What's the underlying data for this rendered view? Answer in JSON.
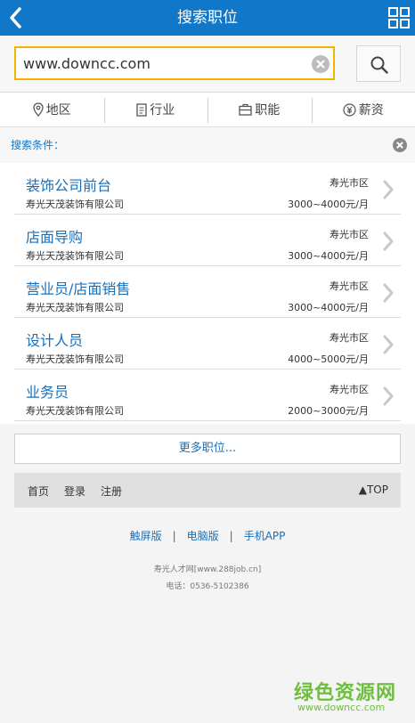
{
  "header": {
    "title": "搜索职位",
    "back_icon": "chevron-left-icon",
    "menu_icon": "grid-icon"
  },
  "search": {
    "value": "www.downcc.com"
  },
  "filters": [
    {
      "label": "地区",
      "icon": "location-pin-icon"
    },
    {
      "label": "行业",
      "icon": "document-icon"
    },
    {
      "label": "职能",
      "icon": "briefcase-icon"
    },
    {
      "label": "薪资",
      "icon": "yen-icon"
    }
  ],
  "criteria": {
    "label": "搜索条件："
  },
  "jobs": [
    {
      "title": "装饰公司前台",
      "company": "寿光天茂装饰有限公司",
      "location": "寿光市区",
      "salary": "3000~4000元/月"
    },
    {
      "title": "店面导购",
      "company": "寿光天茂装饰有限公司",
      "location": "寿光市区",
      "salary": "3000~4000元/月"
    },
    {
      "title": "营业员/店面销售",
      "company": "寿光天茂装饰有限公司",
      "location": "寿光市区",
      "salary": "3000~4000元/月"
    },
    {
      "title": "设计人员",
      "company": "寿光天茂装饰有限公司",
      "location": "寿光市区",
      "salary": "4000~5000元/月"
    },
    {
      "title": "业务员",
      "company": "寿光天茂装饰有限公司",
      "location": "寿光市区",
      "salary": "2000~3000元/月"
    }
  ],
  "more": "更多职位...",
  "footer": {
    "home": "首页",
    "login": "登录",
    "register": "注册",
    "top": "▲TOP"
  },
  "versions": {
    "touch": "触屏版",
    "pc": "电脑版",
    "app": "手机APP",
    "sep": "|"
  },
  "site": "寿光人才网[www.288job.cn]",
  "phone": "电话：0536-5102386",
  "watermark": {
    "main": "绿色资源网",
    "sub": "www.downcc.com"
  },
  "colors": {
    "header": "#1177c8",
    "link": "#1a6fb6",
    "search_border": "#f0b400",
    "watermark": "#6fbf3f"
  }
}
